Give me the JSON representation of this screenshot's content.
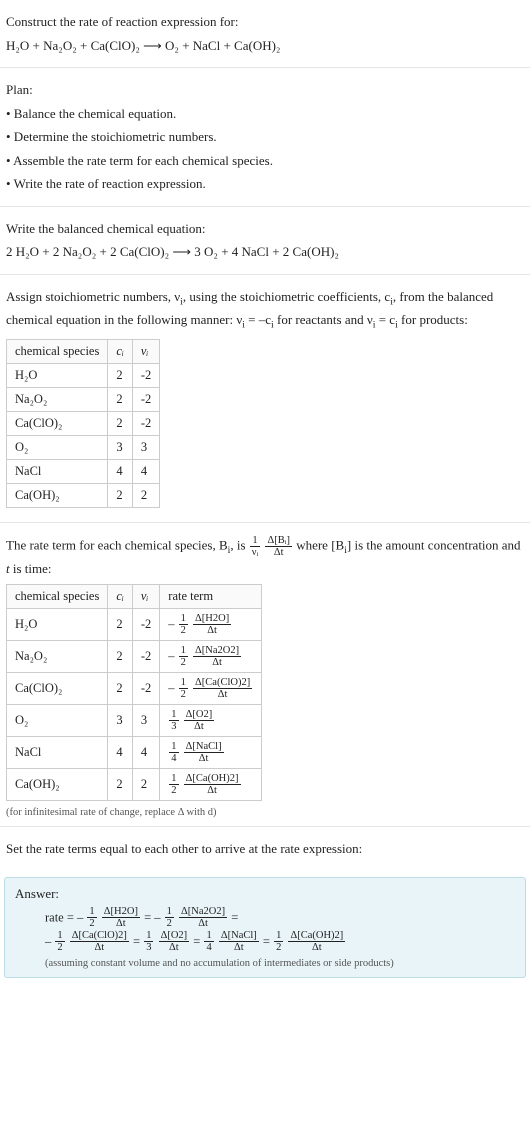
{
  "chart_data": [
    {
      "type": "table",
      "title": "Stoichiometric numbers",
      "columns": [
        "chemical species",
        "c_i",
        "ν_i"
      ],
      "rows": [
        [
          "H₂O",
          2,
          -2
        ],
        [
          "Na₂O₂",
          2,
          -2
        ],
        [
          "Ca(ClO)₂",
          2,
          -2
        ],
        [
          "O₂",
          3,
          3
        ],
        [
          "NaCl",
          4,
          4
        ],
        [
          "Ca(OH)₂",
          2,
          2
        ]
      ]
    },
    {
      "type": "table",
      "title": "Rate terms",
      "columns": [
        "chemical species",
        "c_i",
        "ν_i",
        "rate term"
      ],
      "rows": [
        [
          "H₂O",
          2,
          -2,
          "-(1/2) Δ[H2O]/Δt"
        ],
        [
          "Na₂O₂",
          2,
          -2,
          "-(1/2) Δ[Na2O2]/Δt"
        ],
        [
          "Ca(ClO)₂",
          2,
          -2,
          "-(1/2) Δ[Ca(ClO)2]/Δt"
        ],
        [
          "O₂",
          3,
          3,
          "(1/3) Δ[O2]/Δt"
        ],
        [
          "NaCl",
          4,
          4,
          "(1/4) Δ[NaCl]/Δt"
        ],
        [
          "Ca(OH)₂",
          2,
          2,
          "(1/2) Δ[Ca(OH)2]/Δt"
        ]
      ]
    }
  ],
  "intro": {
    "line1": "Construct the rate of reaction expression for:",
    "equation": "H₂O + Na₂O₂ + Ca(ClO)₂  ⟶  O₂ + NaCl + Ca(OH)₂"
  },
  "plan": {
    "header": "Plan:",
    "b1": "• Balance the chemical equation.",
    "b2": "• Determine the stoichiometric numbers.",
    "b3": "• Assemble the rate term for each chemical species.",
    "b4": "• Write the rate of reaction expression."
  },
  "balanced": {
    "line1": "Write the balanced chemical equation:",
    "equation": "2 H₂O + 2 Na₂O₂ + 2 Ca(ClO)₂  ⟶  3 O₂ + 4 NaCl + 2 Ca(OH)₂"
  },
  "stoich": {
    "intro_a": "Assign stoichiometric numbers, ν",
    "intro_b": ", using the stoichiometric coefficients, c",
    "intro_c": ", from the balanced chemical equation in the following manner: ν",
    "intro_d": " = –c",
    "intro_e": " for reactants and ν",
    "intro_f": " = c",
    "intro_g": " for products:",
    "headers": {
      "h1": "chemical species",
      "h2": "cᵢ",
      "h3": "νᵢ"
    },
    "rows": {
      "r0": {
        "sp": "H₂O",
        "c": "2",
        "v": "-2"
      },
      "r1": {
        "sp": "Na₂O₂",
        "c": "2",
        "v": "-2"
      },
      "r2": {
        "sp": "Ca(ClO)₂",
        "c": "2",
        "v": "-2"
      },
      "r3": {
        "sp": "O₂",
        "c": "3",
        "v": "3"
      },
      "r4": {
        "sp": "NaCl",
        "c": "4",
        "v": "4"
      },
      "r5": {
        "sp": "Ca(OH)₂",
        "c": "2",
        "v": "2"
      }
    }
  },
  "rate_intro": {
    "a": "The rate term for each chemical species, B",
    "b": ", is ",
    "frac1_num": "1",
    "frac1_den": "νᵢ",
    "frac2_num": "Δ[Bᵢ]",
    "frac2_den": "Δt",
    "c": " where [B",
    "d": "] is the amount concentration and ",
    "e": "t",
    "f": " is time:"
  },
  "rate_table": {
    "headers": {
      "h1": "chemical species",
      "h2": "cᵢ",
      "h3": "νᵢ",
      "h4": "rate term"
    },
    "rows": {
      "r0": {
        "sp": "H₂O",
        "c": "2",
        "v": "-2",
        "sign": "– ",
        "fn": "1",
        "fd": "2",
        "dn": "Δ[H2O]",
        "dd": "Δt"
      },
      "r1": {
        "sp": "Na₂O₂",
        "c": "2",
        "v": "-2",
        "sign": "– ",
        "fn": "1",
        "fd": "2",
        "dn": "Δ[Na2O2]",
        "dd": "Δt"
      },
      "r2": {
        "sp": "Ca(ClO)₂",
        "c": "2",
        "v": "-2",
        "sign": "– ",
        "fn": "1",
        "fd": "2",
        "dn": "Δ[Ca(ClO)2]",
        "dd": "Δt"
      },
      "r3": {
        "sp": "O₂",
        "c": "3",
        "v": "3",
        "sign": "",
        "fn": "1",
        "fd": "3",
        "dn": "Δ[O2]",
        "dd": "Δt"
      },
      "r4": {
        "sp": "NaCl",
        "c": "4",
        "v": "4",
        "sign": "",
        "fn": "1",
        "fd": "4",
        "dn": "Δ[NaCl]",
        "dd": "Δt"
      },
      "r5": {
        "sp": "Ca(OH)₂",
        "c": "2",
        "v": "2",
        "sign": "",
        "fn": "1",
        "fd": "2",
        "dn": "Δ[Ca(OH)2]",
        "dd": "Δt"
      }
    },
    "note": "(for infinitesimal rate of change, replace Δ with d)"
  },
  "set_equal": "Set the rate terms equal to each other to arrive at the rate expression:",
  "answer": {
    "label": "Answer:",
    "prefix": "rate = – ",
    "t0": {
      "fn": "1",
      "fd": "2",
      "dn": "Δ[H2O]",
      "dd": "Δt"
    },
    "eq1": " = – ",
    "t1": {
      "fn": "1",
      "fd": "2",
      "dn": "Δ[Na2O2]",
      "dd": "Δt"
    },
    "eq2": " = ",
    "line2_prefix": "– ",
    "t2": {
      "fn": "1",
      "fd": "2",
      "dn": "Δ[Ca(ClO)2]",
      "dd": "Δt"
    },
    "eq3": " = ",
    "t3": {
      "fn": "1",
      "fd": "3",
      "dn": "Δ[O2]",
      "dd": "Δt"
    },
    "eq4": " = ",
    "t4": {
      "fn": "1",
      "fd": "4",
      "dn": "Δ[NaCl]",
      "dd": "Δt"
    },
    "eq5": " = ",
    "t5": {
      "fn": "1",
      "fd": "2",
      "dn": "Δ[Ca(OH)2]",
      "dd": "Δt"
    },
    "note": "(assuming constant volume and no accumulation of intermediates or side products)"
  }
}
